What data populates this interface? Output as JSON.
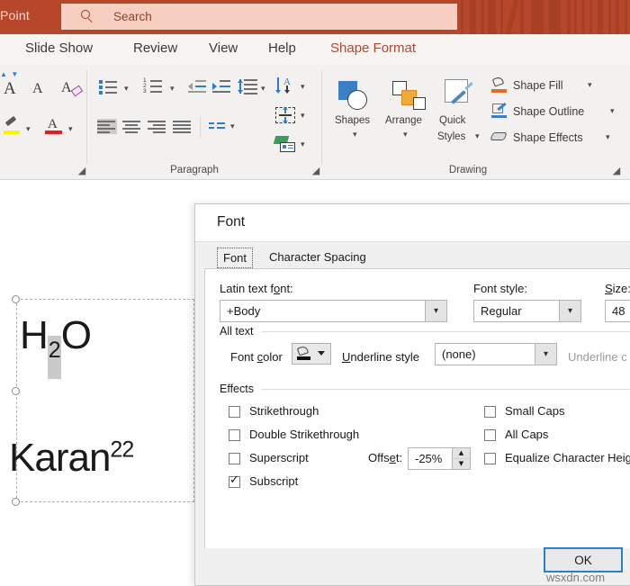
{
  "titlebar": {
    "app_label": "Point",
    "search_placeholder": "Search",
    "search_icon": "search-icon",
    "bg_color": "#b7472a"
  },
  "ribbon": {
    "tabs": [
      {
        "label": "Slide Show",
        "active": false
      },
      {
        "label": "Review",
        "active": false
      },
      {
        "label": "View",
        "active": false
      },
      {
        "label": "Help",
        "active": false
      },
      {
        "label": "Shape Format",
        "active": true
      }
    ],
    "active_tab_color": "#b7472a",
    "groups": [
      {
        "label": "Paragraph"
      },
      {
        "label": "Drawing"
      }
    ],
    "font_group": {
      "increase_font_size_icon": "increase-font-size-icon",
      "decrease_font_size_icon": "decrease-font-size-icon",
      "clear_formatting_icon": "clear-formatting-icon",
      "text_highlight_icon": "text-highlight-color-icon",
      "font_color_icon": "font-color-icon"
    },
    "paragraph_group": {
      "bullets_icon": "bullets-icon",
      "numbering_icon": "numbering-icon",
      "decrease_indent_icon": "decrease-indent-icon",
      "increase_indent_icon": "increase-indent-icon",
      "line_spacing_icon": "line-spacing-icon",
      "align_left_icon": "align-left-icon",
      "align_center_icon": "align-center-icon",
      "align_right_icon": "align-right-icon",
      "justify_icon": "justify-icon",
      "columns_icon": "columns-icon",
      "text_direction_icon": "text-direction-icon",
      "align_text_icon": "align-text-icon",
      "smartart_icon": "convert-to-smartart-icon"
    },
    "drawing_group": {
      "shapes_label": "Shapes",
      "arrange_label": "Arrange",
      "quick_styles_label_1": "Quick",
      "quick_styles_label_2": "Styles",
      "shape_fill_label": "Shape Fill",
      "shape_outline_label": "Shape Outline",
      "shape_effects_label": "Shape Effects",
      "shape_fill_icon": "shape-fill-icon",
      "shape_outline_icon": "shape-outline-icon",
      "shape_effects_icon": "shape-effects-icon"
    }
  },
  "slide": {
    "text_h2o": {
      "base1": "H",
      "sub": "2",
      "base2": "O"
    },
    "text_karan": {
      "base": "Karan",
      "sup": "22"
    }
  },
  "dialog": {
    "title": "Font",
    "tabs": [
      {
        "label": "Font",
        "selected": true
      },
      {
        "label": "Character Spacing",
        "selected": false
      }
    ],
    "latin_font_label": "Latin text font:",
    "latin_font_value": "+Body",
    "font_style_label": "Font style:",
    "font_style_value": "Regular",
    "size_label": "Size:",
    "size_value": "48",
    "all_text_group_label": "All text",
    "font_color_label": "Font color",
    "underline_style_label": "Underline style",
    "underline_style_value": "(none)",
    "underline_color_label": "Underline c",
    "effects_group_label": "Effects",
    "effects_left": [
      {
        "label": "Strikethrough",
        "checked": false
      },
      {
        "label": "Double Strikethrough",
        "checked": false
      },
      {
        "label": "Superscript",
        "checked": false
      },
      {
        "label": "Subscript",
        "checked": true
      }
    ],
    "effects_right": [
      {
        "label": "Small Caps",
        "checked": false
      },
      {
        "label": "All Caps",
        "checked": false
      },
      {
        "label": "Equalize Character Height",
        "checked": false
      }
    ],
    "offset_label": "Offset:",
    "offset_value": "-25%",
    "ok_label": "OK",
    "focus_color": "#2a7fd4"
  },
  "watermark": {
    "text": "wsxdn.com"
  }
}
